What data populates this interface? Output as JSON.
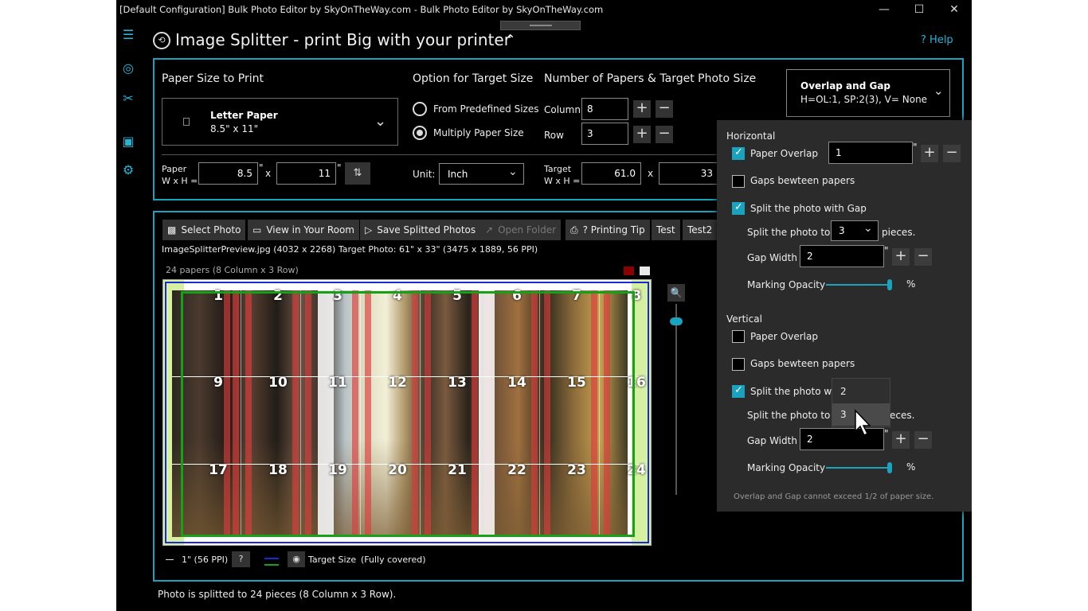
{
  "window": {
    "title": "[Default Configuration] Bulk Photo Editor by SkyOnTheWay.com - Bulk Photo Editor by SkyOnTheWay.com",
    "minimize": "—",
    "maximize": "☐",
    "close": "✕"
  },
  "header": {
    "title": "Image Splitter - print Big with your printer",
    "help": "Help"
  },
  "paper_size": {
    "heading": "Paper Size to Print",
    "selected_name": "Letter Paper",
    "selected_size": "8.5\" x 11\"",
    "wh_label_1": "Paper",
    "wh_label_2": "W x H =",
    "width": "8.5",
    "height": "11",
    "inch_mark": "\"",
    "x": "x"
  },
  "target_option": {
    "heading": "Option for Target Size",
    "options": [
      "From Predefined Sizes",
      "Multiply Paper Size"
    ],
    "selected_index": 1,
    "unit_label": "Unit:",
    "unit_value": "Inch"
  },
  "papers": {
    "heading": "Number of Papers & Target Photo Size",
    "column_label": "Column",
    "column_value": "8",
    "row_label": "Row",
    "row_value": "3",
    "target_label_1": "Target",
    "target_label_2": "W x H =",
    "target_w": "61.0",
    "target_h": "33",
    "x": "x"
  },
  "overlap_gap": {
    "title": "Overlap and Gap",
    "summary": "H=OL:1, SP:2(3), V= None"
  },
  "toolbar": {
    "select_photo": "Select Photo",
    "view_room": "View in Your Room",
    "save_split": "Save Splitted Photos",
    "open_folder": "Open Folder",
    "printing_tip": "? Printing Tip",
    "test": "Test",
    "test2": "Test2"
  },
  "file_info": "ImageSplitterPreview.jpg (4032 x 2268)   Target Photo: 61\" x 33\" (3475 x 1889, 56 PPI)",
  "papers_count": "24 papers (8 Column x 3 Row)",
  "swatches": {
    "red": "#8b0000",
    "white": "#e8e8e8"
  },
  "grid": {
    "columns": 8,
    "rows": 3,
    "labels": [
      "1",
      "2",
      "3",
      "4",
      "5",
      "6",
      "7",
      "8",
      "9",
      "10",
      "11",
      "12",
      "13",
      "14",
      "15",
      "16",
      "17",
      "18",
      "19",
      "20",
      "21",
      "22",
      "23",
      "24"
    ]
  },
  "legend": {
    "scale": "1\" (56 PPI)",
    "help": "?",
    "target_size": "Target Size",
    "fully_covered": "(Fully covered)"
  },
  "flyout": {
    "horizontal": {
      "heading": "Horizontal",
      "paper_overlap": "Paper Overlap",
      "paper_overlap_checked": true,
      "overlap_value": "1",
      "gaps_between": "Gaps bewteen papers",
      "gaps_checked": false,
      "split_with_gap": "Split the photo with Gap",
      "split_checked": true,
      "split_to_label": "Split the photo to",
      "split_to_value": "3",
      "pieces": "pieces.",
      "gap_width_label": "Gap Width",
      "gap_width_value": "2",
      "opacity_label": "Marking Opacity",
      "percent": "%",
      "inch_mark": "\""
    },
    "vertical": {
      "heading": "Vertical",
      "paper_overlap": "Paper Overlap",
      "paper_overlap_checked": false,
      "gaps_between": "Gaps bewteen papers",
      "gaps_checked": false,
      "split_with_gap": "Split the photo wit",
      "split_checked": true,
      "split_to_label": "Split the photo to",
      "pieces": "eces.",
      "gap_width_label": "Gap Width",
      "gap_width_value": "2",
      "opacity_label": "Marking Opacity",
      "percent": "%",
      "inch_mark": "\""
    },
    "note": "Overlap and Gap cannot exceed 1/2 of paper size.",
    "dropdown_options": [
      "2",
      "3"
    ],
    "dropdown_selected": "3"
  },
  "status": "Photo is splitted to 24 pieces (8 Column x 3 Row).",
  "colors": {
    "accent": "#1aa3bf",
    "background": "#000000",
    "overlap_marker": "#dc3c3c",
    "target_rect": "#19a019",
    "paper_rect": "#1a2ad0"
  }
}
